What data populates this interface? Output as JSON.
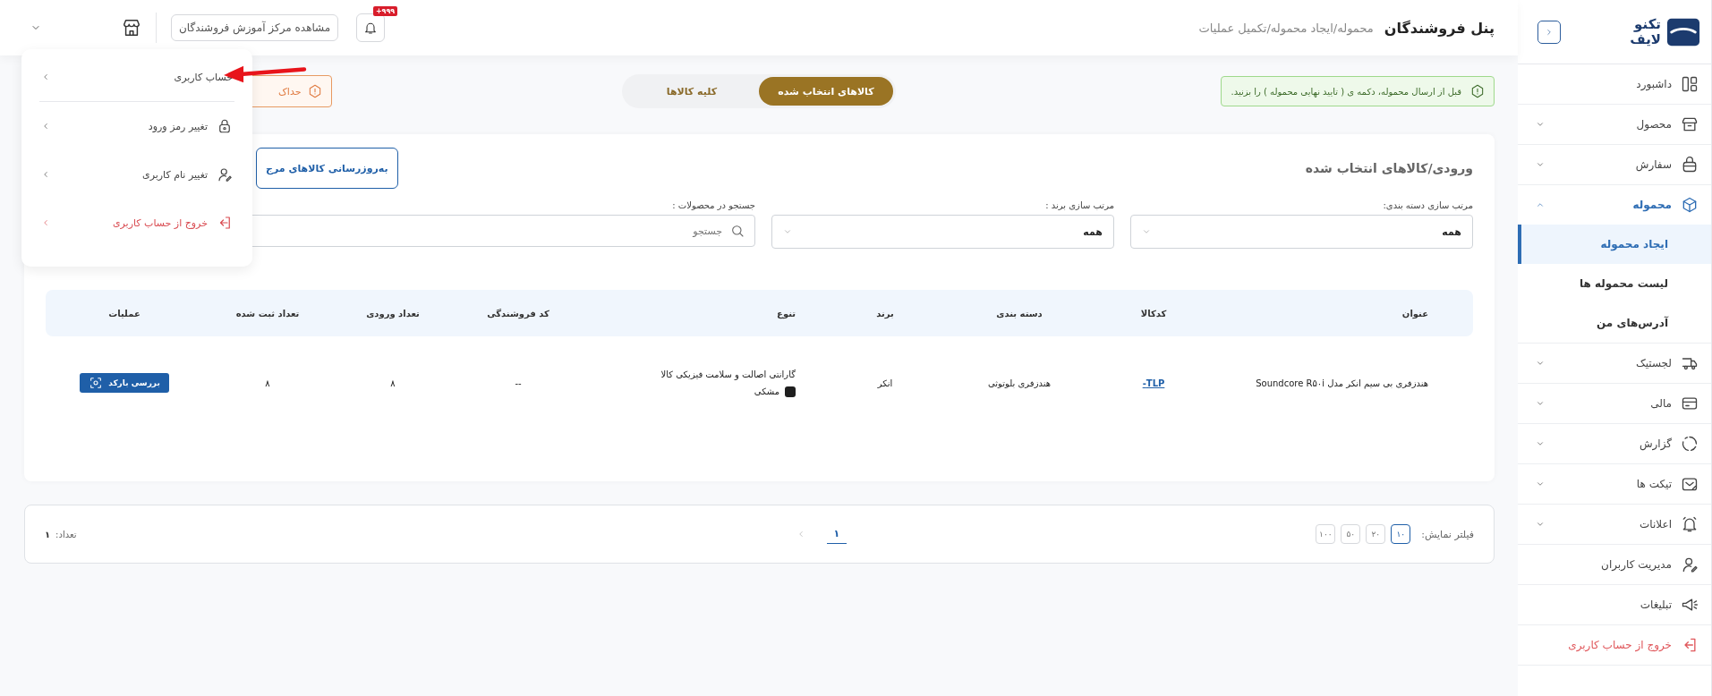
{
  "sidebar": {
    "logo": {
      "line_1": "تکنو",
      "line_2": "لایف"
    },
    "items": [
      {
        "label": "داشبورد",
        "kind": "link",
        "selected": false
      },
      {
        "label": "محصول",
        "kind": "group",
        "selected": false,
        "expanded": false
      },
      {
        "label": "سفارش",
        "kind": "group",
        "selected": false,
        "expanded": false
      },
      {
        "label": "محموله",
        "kind": "group",
        "selected": true,
        "expanded": true,
        "children": [
          {
            "label": "ایجاد محموله",
            "selected": true
          },
          {
            "label": "لیست محموله ها",
            "selected": false
          },
          {
            "label": "آدرس‌های من",
            "selected": false
          }
        ]
      },
      {
        "label": "لجستیک",
        "kind": "group",
        "selected": false,
        "expanded": false
      },
      {
        "label": "مالی",
        "kind": "group",
        "selected": false,
        "expanded": false
      },
      {
        "label": "گزارش",
        "kind": "group",
        "selected": false,
        "expanded": false
      },
      {
        "label": "تیکت ها",
        "kind": "group",
        "selected": false,
        "expanded": false
      },
      {
        "label": "اعلانات",
        "kind": "group",
        "selected": false,
        "expanded": false
      },
      {
        "label": "مدیریت کاربران",
        "kind": "link",
        "selected": false
      },
      {
        "label": "تبلیغات",
        "kind": "link",
        "selected": false
      },
      {
        "label": "خروج از حساب کاربری",
        "kind": "danger",
        "selected": false
      }
    ]
  },
  "header": {
    "title": "پنل فروشندگان",
    "breadcrumb": "محموله/ایجاد محموله/تکمیل عملیات",
    "training_button": "مشاهده مرکز آموزش فروشندگان",
    "notification_badge": "+۹۹۹"
  },
  "user_menu": {
    "expanded": true,
    "items": [
      {
        "label": "حساب کاربری",
        "kind": "normal"
      },
      {
        "label": "تغییر رمز ورود",
        "kind": "normal"
      },
      {
        "label": "تغییر نام کاربری",
        "kind": "normal"
      },
      {
        "label": "خروج از حساب کاربری",
        "kind": "danger"
      }
    ]
  },
  "warning": {
    "text": "حداک"
  },
  "tabs": [
    {
      "label": "کالاهای انتخاب شده",
      "selected": true
    },
    {
      "label": "کلیه کالاها",
      "selected": false
    }
  ],
  "notice": {
    "text": "قبل از ارسال محموله، دکمه ی ( تایید نهایی محموله ) را بزنید."
  },
  "card": {
    "title": "ورودی/کالاهای انتخاب شده",
    "refresh_button": "به‌روزرسانی کالاهای مرج",
    "filters": [
      {
        "label": "مرتب سازی دسته بندی:",
        "kind": "select",
        "value": "همه"
      },
      {
        "label": "مرتب سازی برند :",
        "kind": "select",
        "value": "همه"
      },
      {
        "label": "جستجو در محصولات :",
        "kind": "search",
        "placeholder": "جستجو"
      }
    ],
    "table": {
      "columns": [
        "عنوان",
        "کدکالا",
        "دسته بندی",
        "برند",
        "تنوع",
        "کد فروشندگی",
        "تعداد ورودی",
        "تعداد ثبت شده",
        "عملیات"
      ],
      "rows": [
        {
          "title": "هندزفری بی سیم انکر مدل Soundcore R۵۰i",
          "code": "TLP-",
          "category": "هندزفری بلوتوثی",
          "brand": "انکر",
          "variety": {
            "warranty": "گارانتی اصالت و سلامت فیزیکی کالا",
            "color_name": "مشکی",
            "color": "#1e1e1e"
          },
          "seller_code": "--",
          "input_count": "۸",
          "registered_count": "۸",
          "action": "بررسی بارکد"
        }
      ]
    }
  },
  "pagination": {
    "label": "فیلتر نمایش:",
    "page_sizes": [
      {
        "label": "۱۰",
        "selected": true
      },
      {
        "label": "۲۰",
        "selected": false
      },
      {
        "label": "۵۰",
        "selected": false
      },
      {
        "label": "۱۰۰",
        "selected": false
      }
    ],
    "pages": [
      {
        "label": "۱",
        "selected": true
      }
    ],
    "count_label": "تعداد:",
    "count": "۱"
  }
}
